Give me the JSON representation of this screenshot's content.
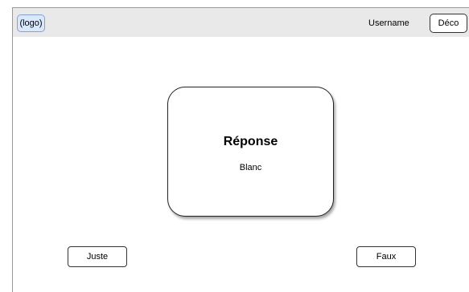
{
  "header": {
    "logo_label": "(logo)",
    "username": "Username",
    "logout_label": "Déco"
  },
  "card": {
    "title": "Réponse",
    "value": "Blanc"
  },
  "actions": {
    "correct_label": "Juste",
    "wrong_label": "Faux"
  }
}
